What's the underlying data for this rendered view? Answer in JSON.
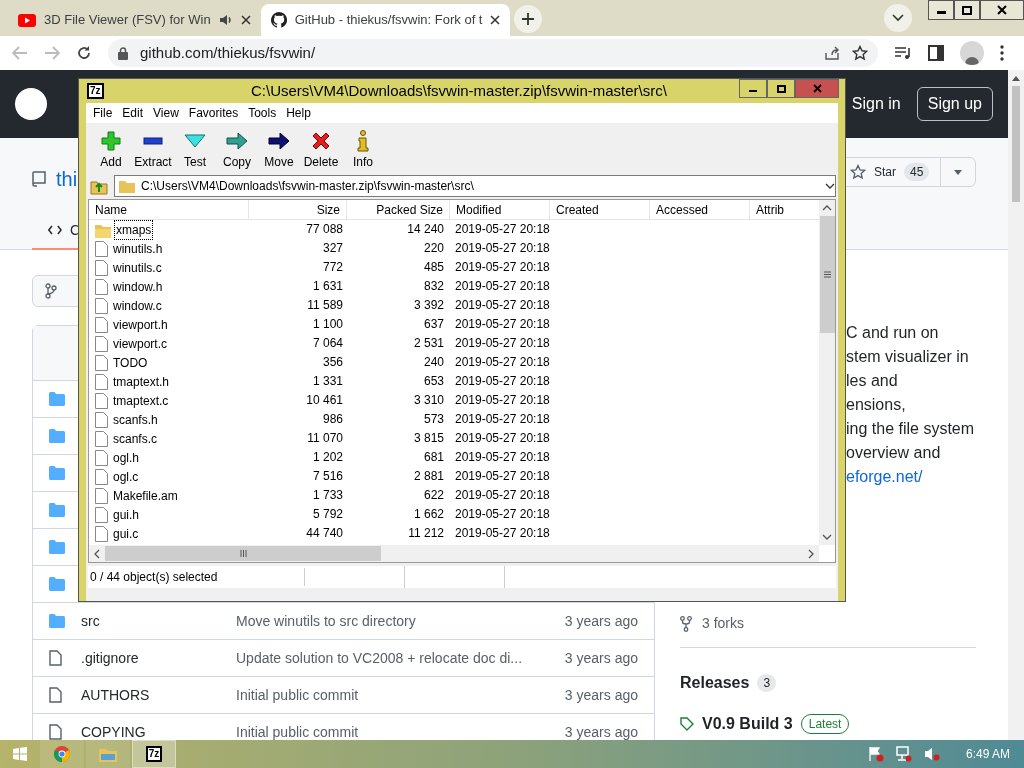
{
  "browser": {
    "tabs": [
      {
        "title": "3D File Viewer (FSV) for Win",
        "kind": "video",
        "audio": true,
        "selected": false
      },
      {
        "title": "GitHub - thiekus/fsvwin: Fork of t",
        "kind": "github",
        "audio": false,
        "selected": true
      }
    ],
    "url": "github.com/thiekus/fsvwin/"
  },
  "github": {
    "sign_in": "Sign in",
    "sign_up": "Sign up",
    "repo_owner": "thi",
    "star_label": "Star",
    "star_count": "45",
    "code_tab": "C",
    "files": [
      {
        "kind": "folder"
      },
      {
        "kind": "folder"
      },
      {
        "kind": "folder"
      },
      {
        "kind": "folder"
      },
      {
        "kind": "folder"
      },
      {
        "kind": "folder"
      },
      {
        "kind": "folder",
        "name": "src",
        "message": "Move winutils to src directory",
        "age": "3 years ago"
      },
      {
        "kind": "file",
        "name": ".gitignore",
        "message": "Update solution to VC2008 + relocate doc di...",
        "age": "3 years ago"
      },
      {
        "kind": "file",
        "name": "AUTHORS",
        "message": "Initial public commit",
        "age": "3 years ago"
      },
      {
        "kind": "file",
        "name": "COPYING",
        "message": "Initial public commit",
        "age": "3 years ago"
      }
    ],
    "about_lines": [
      "C and run on",
      "stem visualizer in",
      "les and",
      "ensions,",
      "ing the file system",
      "overview and"
    ],
    "about_link": "eforge.net/",
    "forks": "3 forks",
    "releases_title": "Releases",
    "releases_count": "3",
    "release_name": "V0.9 Build 3",
    "release_badge": "Latest"
  },
  "archiver": {
    "icon_text": "7z",
    "title": "C:\\Users\\VM4\\Downloads\\fsvwin-master.zip\\fsvwin-master\\src\\",
    "menu": [
      "File",
      "Edit",
      "View",
      "Favorites",
      "Tools",
      "Help"
    ],
    "toolbar": [
      {
        "label": "Add",
        "kind": "add"
      },
      {
        "label": "Extract",
        "kind": "extract"
      },
      {
        "label": "Test",
        "kind": "test"
      },
      {
        "label": "Copy",
        "kind": "copy"
      },
      {
        "label": "Move",
        "kind": "move"
      },
      {
        "label": "Delete",
        "kind": "delete"
      },
      {
        "label": "Info",
        "kind": "info"
      }
    ],
    "path": "C:\\Users\\VM4\\Downloads\\fsvwin-master.zip\\fsvwin-master\\src\\",
    "columns": [
      "Name",
      "Size",
      "Packed Size",
      "Modified",
      "Created",
      "Accessed",
      "Attrib"
    ],
    "rows": [
      {
        "name": "xmaps",
        "kind": "folder",
        "size": "77 088",
        "packed": "14 240",
        "modified": "2019-05-27 20:18",
        "focused": true
      },
      {
        "name": "winutils.h",
        "kind": "file",
        "size": "327",
        "packed": "220",
        "modified": "2019-05-27 20:18",
        "focused": false
      },
      {
        "name": "winutils.c",
        "kind": "file",
        "size": "772",
        "packed": "485",
        "modified": "2019-05-27 20:18",
        "focused": false
      },
      {
        "name": "window.h",
        "kind": "file",
        "size": "1 631",
        "packed": "832",
        "modified": "2019-05-27 20:18",
        "focused": false
      },
      {
        "name": "window.c",
        "kind": "file",
        "size": "11 589",
        "packed": "3 392",
        "modified": "2019-05-27 20:18",
        "focused": false
      },
      {
        "name": "viewport.h",
        "kind": "file",
        "size": "1 100",
        "packed": "637",
        "modified": "2019-05-27 20:18",
        "focused": false
      },
      {
        "name": "viewport.c",
        "kind": "file",
        "size": "7 064",
        "packed": "2 531",
        "modified": "2019-05-27 20:18",
        "focused": false
      },
      {
        "name": "TODO",
        "kind": "file",
        "size": "356",
        "packed": "240",
        "modified": "2019-05-27 20:18",
        "focused": false
      },
      {
        "name": "tmaptext.h",
        "kind": "file",
        "size": "1 331",
        "packed": "653",
        "modified": "2019-05-27 20:18",
        "focused": false
      },
      {
        "name": "tmaptext.c",
        "kind": "file",
        "size": "10 461",
        "packed": "3 310",
        "modified": "2019-05-27 20:18",
        "focused": false
      },
      {
        "name": "scanfs.h",
        "kind": "file",
        "size": "986",
        "packed": "573",
        "modified": "2019-05-27 20:18",
        "focused": false
      },
      {
        "name": "scanfs.c",
        "kind": "file",
        "size": "11 070",
        "packed": "3 815",
        "modified": "2019-05-27 20:18",
        "focused": false
      },
      {
        "name": "ogl.h",
        "kind": "file",
        "size": "1 202",
        "packed": "681",
        "modified": "2019-05-27 20:18",
        "focused": false
      },
      {
        "name": "ogl.c",
        "kind": "file",
        "size": "7 516",
        "packed": "2 881",
        "modified": "2019-05-27 20:18",
        "focused": false
      },
      {
        "name": "Makefile.am",
        "kind": "file",
        "size": "1 733",
        "packed": "622",
        "modified": "2019-05-27 20:18",
        "focused": false
      },
      {
        "name": "gui.h",
        "kind": "file",
        "size": "5 792",
        "packed": "1 662",
        "modified": "2019-05-27 20:18",
        "focused": false
      },
      {
        "name": "gui.c",
        "kind": "file",
        "size": "44 740",
        "packed": "11 212",
        "modified": "2019-05-27 20:18",
        "focused": false
      }
    ],
    "status": "0 / 44 object(s) selected"
  },
  "taskbar": {
    "apps": [
      {
        "kind": "chrome",
        "selected": false
      },
      {
        "kind": "explorer",
        "selected": false
      },
      {
        "kind": "archiver",
        "icon_text": "7z",
        "selected": true
      }
    ],
    "clock": "6:49 AM"
  }
}
